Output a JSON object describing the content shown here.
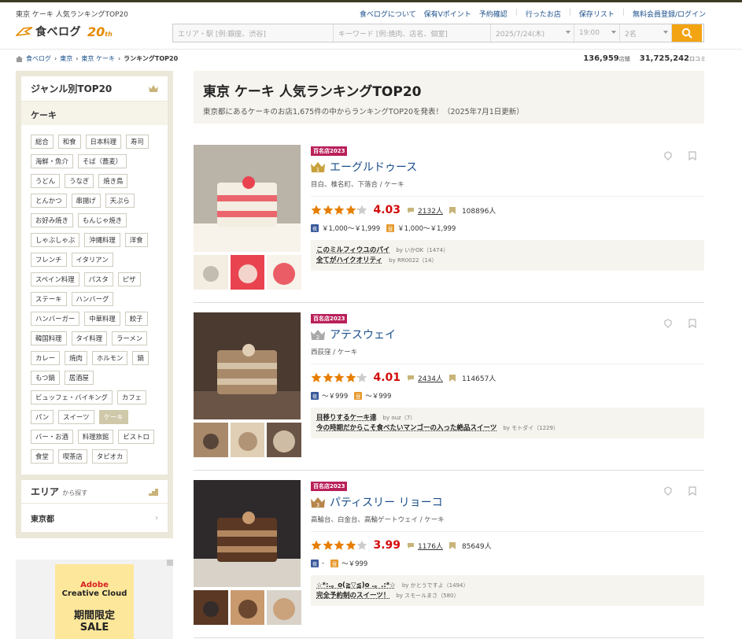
{
  "tagline": "東京 ケーキ 人気ランキングTOP20",
  "toplinks": [
    "食べログについて",
    "保有Vポイント",
    "予約確認",
    "行ったお店",
    "保存リスト",
    "無料会員登録/ログイン"
  ],
  "logo": {
    "name": "食べログ",
    "anniv": "20",
    "anniv_suffix": "th"
  },
  "search": {
    "area_placeholder": "エリア・駅 [例:銀座、渋谷]",
    "keyword_placeholder": "キーワード [例:焼肉、店名、個室]",
    "date": "2025/7/24(木)",
    "time": "19:00",
    "people": "2名"
  },
  "breadcrumb": [
    "食べログ",
    "東京",
    "東京 ケーキ",
    "ランキングTOP20"
  ],
  "counts": {
    "shops": "136,959",
    "shops_unit": "店舗",
    "reviews": "31,725,242",
    "reviews_unit": "口コミ"
  },
  "sidebar": {
    "genre_title": "ジャンル別TOP20",
    "current": "ケーキ",
    "tags": [
      "総合",
      "和食",
      "日本料理",
      "寿司",
      "海鮮・魚介",
      "そば（蕎麦）",
      "うどん",
      "うなぎ",
      "焼き鳥",
      "とんかつ",
      "串揚げ",
      "天ぷら",
      "お好み焼き",
      "もんじゃ焼き",
      "しゃぶしゃぶ",
      "沖縄料理",
      "洋食",
      "フレンチ",
      "イタリアン",
      "スペイン料理",
      "パスタ",
      "ピザ",
      "ステーキ",
      "ハンバーグ",
      "ハンバーガー",
      "中華料理",
      "餃子",
      "韓国料理",
      "タイ料理",
      "ラーメン",
      "カレー",
      "焼肉",
      "ホルモン",
      "鍋",
      "もつ鍋",
      "居酒屋",
      "ビュッフェ・バイキング",
      "カフェ",
      "パン",
      "スイーツ",
      "ケーキ",
      "バー・お酒",
      "料理旅館",
      "ビストロ",
      "食堂",
      "喫茶店",
      "タピオカ"
    ],
    "area_title": "エリア",
    "area_sub": "から探す",
    "area_value": "東京都"
  },
  "ad": {
    "l1": "Adobe",
    "l2": "Creative Cloud",
    "l3": "期間限定",
    "l4": "SALE"
  },
  "main": {
    "title": "東京 ケーキ 人気ランキングTOP20",
    "subtitle": "東京都にあるケーキのお店1,675件の中からランキングTOP20を発表！（2025年7月1日更新）"
  },
  "items": [
    {
      "rank": "1",
      "badge": "百名店2023",
      "name": "エーグルドゥース",
      "genre": "目白、椎名町、下落合 / ケーキ",
      "rating": 4.03,
      "score": "4.03",
      "reviews": "2132人",
      "bookmarks": "108896人",
      "dinner": "￥1,000～￥1,999",
      "lunch": "￥1,000～￥1,999",
      "rev": [
        {
          "t": "このミルフィウユのパイ",
          "by": "by いかOK（1474）"
        },
        {
          "t": "全てがハイクオリティ",
          "by": "by RR0022（14）"
        }
      ],
      "color": "#c8a13c"
    },
    {
      "rank": "2",
      "badge": "百名店2023",
      "name": "アテスウェイ",
      "genre": "西荻窪 / ケーキ",
      "rating": 4.01,
      "score": "4.01",
      "reviews": "2434人",
      "bookmarks": "114657人",
      "dinner": "～￥999",
      "lunch": "～￥999",
      "rev": [
        {
          "t": "目移りするケーキ達",
          "by": "by ouz（7）"
        },
        {
          "t": "今の時期だからこそ食べたいマンゴーの入った絶品スイーツ",
          "by": "by モトダイ（1229）"
        }
      ],
      "color": "#a9a9a9"
    },
    {
      "rank": "3",
      "badge": "百名店2023",
      "name": "パティスリー リョーコ",
      "genre": "高輪台、白金台、高輪ゲートウェイ / ケーキ",
      "rating": 3.99,
      "score": "3.99",
      "reviews": "1176人",
      "bookmarks": "85649人",
      "dinner": "-",
      "lunch": "～￥999",
      "rev": [
        {
          "t": "☆*:.。o(≧▽≦)o .。.:*☆",
          "by": "by かとうですよ（1494）"
        },
        {
          "t": "完全予約制のスイーツ！",
          "by": "by スモールまさ（580）"
        }
      ],
      "color": "#b8854a"
    }
  ]
}
